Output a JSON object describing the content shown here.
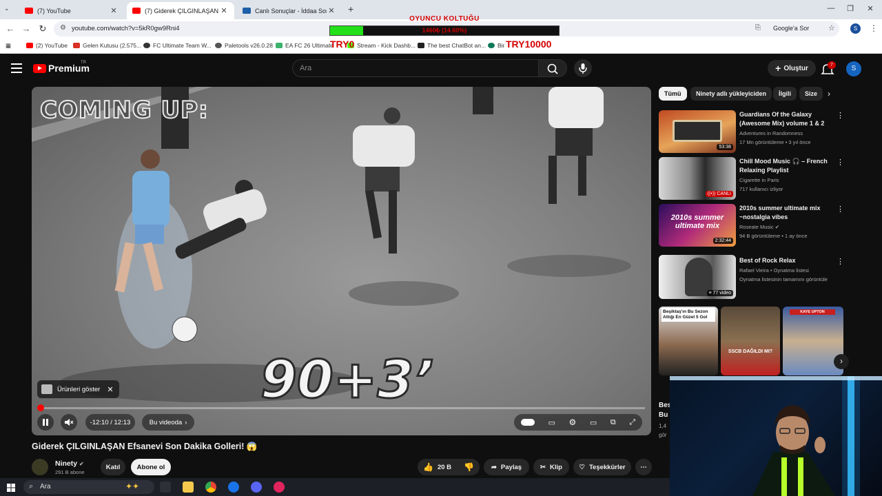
{
  "browser": {
    "tabs": [
      {
        "title": "(7) YouTube",
        "active": false
      },
      {
        "title": "(7) Giderek ÇILGINLAŞAN E",
        "active": true
      },
      {
        "title": "Canlı Sonuçlar - İddaa Sonuçlar",
        "active": false
      }
    ],
    "new_tab": "+",
    "url": "youtube.com/watch?v=5kR0gw9Rni4",
    "google_sor": "Google'a Sor",
    "profile_initial": "S",
    "bookmarks": [
      "(2) YouTube",
      "Gelen Kutusu (2.575...",
      "FC Ultimate Team W...",
      "Paletools v26.0.28",
      "EA FC 26 Ultimate",
      "Stream - Kick Dashb...",
      "The best ChatBot an...",
      "Bir"
    ]
  },
  "overlay": {
    "title": "OYUNCU KOLTUĞU",
    "bar_text": "1460₺ (14.60%)",
    "progress": 0.146,
    "left_label": "TRY0",
    "right_label": "TRY10000"
  },
  "youtube": {
    "logo_text": "Premium",
    "logo_region": "TR",
    "search_placeholder": "Ara",
    "create_label": "Oluştur",
    "notifications": "7",
    "avatar_initial": "S"
  },
  "video": {
    "coming_up": "COMING UP:",
    "timer_text": "90+3’",
    "products_label": "Ürünleri göster",
    "time": "-12:10 / 12:13",
    "chapter": "Bu videoda",
    "progress": 0.004,
    "title": "Giderek ÇILGINLAŞAN Efsanevi Son Dakika Golleri! 😱",
    "channel": "Ninety",
    "subs": "291 B abone",
    "join": "Katıl",
    "subscribe": "Abone ol",
    "likes": "20 B",
    "share": "Paylaş",
    "clip": "Klip",
    "thanks": "Teşekkürler"
  },
  "chips": [
    "Tümü",
    "Ninety adlı yükleyiciden",
    "İlgili",
    "Size"
  ],
  "recommendations": [
    {
      "title": "Guardians Of the Galaxy (Awesome Mix) volume 1 & 2",
      "channel": "Adventures in Randomness",
      "meta": "17 Mn görüntüleme • 3 yıl önce",
      "badge": "53:38"
    },
    {
      "title": "Chill Mood Music 🎧 – French Relaxing Playlist",
      "channel": "Cigarette in Paris",
      "meta": "717 kullanıcı izliyor",
      "badge": "CANLI"
    },
    {
      "title": "2010s summer ultimate mix ~nostalgia vibes",
      "channel": "Roseate Music",
      "meta": "94 B görüntüleme • 1 ay önce",
      "badge": "2:32:44",
      "thumb_text": "2010s summer ultimate mix"
    },
    {
      "title": "Best of Rock Relax",
      "channel": "Rafael Vieira • Oynatma listesi",
      "meta": "Oynatma listesinin tamamını görüntüle",
      "badge": "77 video"
    }
  ],
  "shorts": [
    {
      "caption": "Beşiktaş'ın Bu Sezon Attığı En Güzel 5 Gol"
    },
    {
      "caption": "SSCB DAĞILDI MI?"
    },
    {
      "caption": "KAYE UPTON"
    }
  ],
  "below_shorts": {
    "line1": "Bes",
    "line2": "Bu",
    "line3": "1,4",
    "line4": "gör"
  },
  "taskbar": {
    "search": "Ara"
  }
}
